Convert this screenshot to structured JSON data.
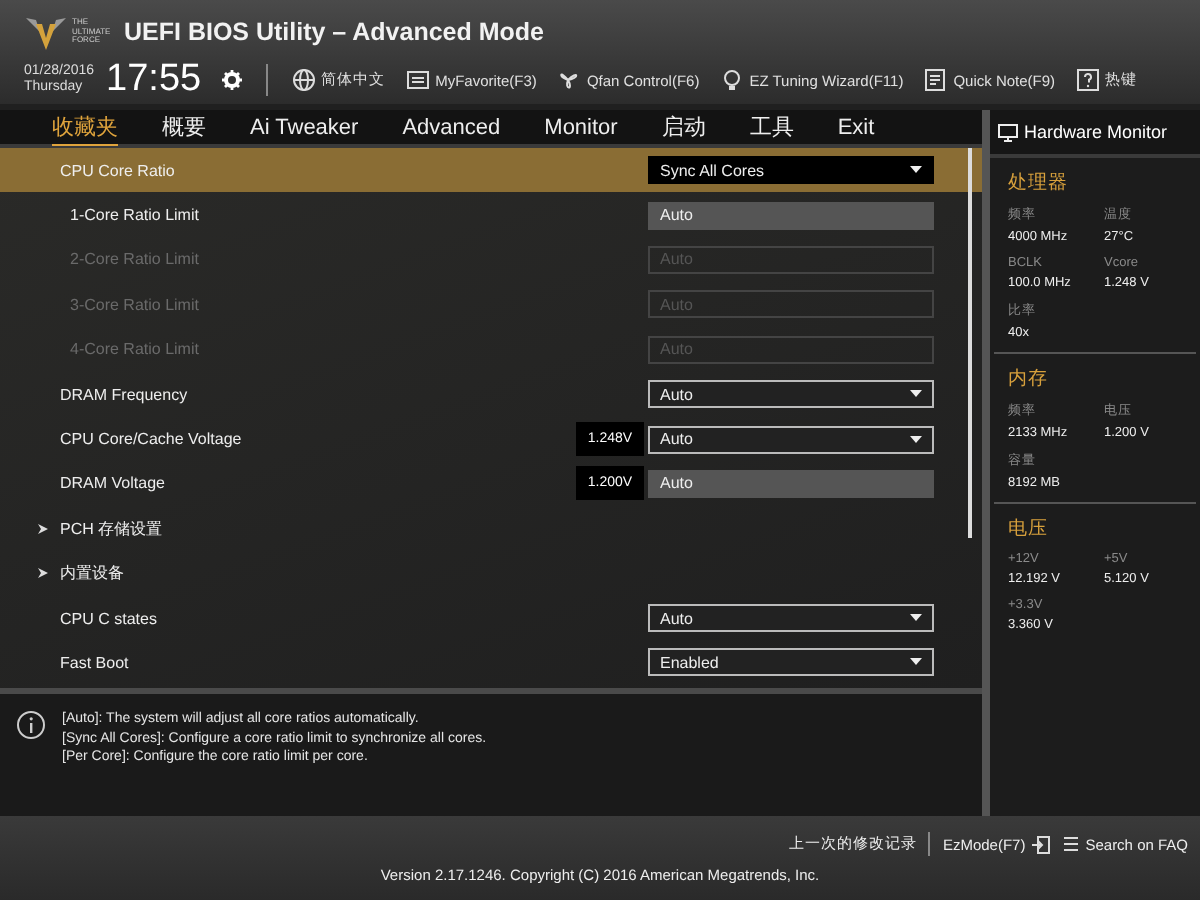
{
  "header": {
    "logo_text": "THE ULTIMATE FORCE",
    "title": "UEFI BIOS Utility – Advanced Mode",
    "date": "01/28/2016",
    "day": "Thursday",
    "time": "17:55",
    "tools": [
      {
        "label": "简体中文"
      },
      {
        "label": "MyFavorite(F3)"
      },
      {
        "label": "Qfan Control(F6)"
      },
      {
        "label": "EZ Tuning Wizard(F11)"
      },
      {
        "label": "Quick Note(F9)"
      },
      {
        "label": "热键"
      }
    ]
  },
  "tabs": [
    {
      "label": "收藏夹",
      "selected": true
    },
    {
      "label": "概要",
      "selected": false
    },
    {
      "label": "Ai Tweaker",
      "selected": false
    },
    {
      "label": "Advanced",
      "selected": false
    },
    {
      "label": "Monitor",
      "selected": false
    },
    {
      "label": "启动",
      "selected": false
    },
    {
      "label": "工具",
      "selected": false
    },
    {
      "label": "Exit",
      "selected": false
    }
  ],
  "settings": [
    {
      "kind": "dropdown",
      "label": "CPU Core Ratio",
      "value": "Sync All Cores",
      "selected": true,
      "disabled": false
    },
    {
      "kind": "field",
      "label": "1-Core Ratio Limit",
      "value": "Auto",
      "selected": false,
      "disabled": false,
      "indent": true
    },
    {
      "kind": "field",
      "label": "2-Core Ratio Limit",
      "value": "Auto",
      "selected": false,
      "disabled": true,
      "indent": true
    },
    {
      "kind": "field",
      "label": "3-Core Ratio Limit",
      "value": "Auto",
      "selected": false,
      "disabled": true,
      "indent": true
    },
    {
      "kind": "field",
      "label": "4-Core Ratio Limit",
      "value": "Auto",
      "selected": false,
      "disabled": true,
      "indent": true
    },
    {
      "kind": "dropdown",
      "label": "DRAM Frequency",
      "value": "Auto",
      "selected": false,
      "disabled": false
    },
    {
      "kind": "dropdown",
      "label": "CPU Core/Cache Voltage",
      "value": "Auto",
      "reading": "1.248V",
      "selected": false,
      "disabled": false
    },
    {
      "kind": "field",
      "label": "DRAM Voltage",
      "value": "Auto",
      "reading": "1.200V",
      "selected": false,
      "disabled": false
    },
    {
      "kind": "submenu",
      "label": "PCH 存储设置",
      "selected": false,
      "disabled": false
    },
    {
      "kind": "submenu",
      "label": "内置设备",
      "selected": false,
      "disabled": false
    },
    {
      "kind": "dropdown",
      "label": "CPU C states",
      "value": "Auto",
      "selected": false,
      "disabled": false
    },
    {
      "kind": "dropdown",
      "label": "Fast Boot",
      "value": "Enabled",
      "selected": false,
      "disabled": false
    }
  ],
  "help": [
    "[Auto]: The system will adjust all core ratios automatically.",
    "[Sync All Cores]: Configure a core ratio limit to synchronize all cores.",
    "[Per Core]: Configure the core ratio limit per core."
  ],
  "hardware_monitor": {
    "title": "Hardware Monitor",
    "sections": [
      {
        "title": "处理器",
        "items": [
          {
            "label": "频率",
            "value": "4000 MHz"
          },
          {
            "label": "温度",
            "value": "27°C"
          },
          {
            "label": "BCLK",
            "value": "100.0 MHz"
          },
          {
            "label": "Vcore",
            "value": "1.248 V"
          },
          {
            "label": "比率",
            "value": "40x"
          }
        ]
      },
      {
        "title": "内存",
        "items": [
          {
            "label": "频率",
            "value": "2133 MHz"
          },
          {
            "label": "电压",
            "value": "1.200 V"
          },
          {
            "label": "容量",
            "value": "8192 MB"
          }
        ]
      },
      {
        "title": "电压",
        "items": [
          {
            "label": "+12V",
            "value": "12.192 V"
          },
          {
            "label": "+5V",
            "value": "5.120 V"
          },
          {
            "label": "+3.3V",
            "value": "3.360 V"
          }
        ]
      }
    ]
  },
  "footer": {
    "links": [
      "上一次的修改记录",
      "EzMode(F7)",
      "Search on FAQ"
    ],
    "version": "Version 2.17.1246. Copyright (C) 2016 American Megatrends, Inc."
  }
}
